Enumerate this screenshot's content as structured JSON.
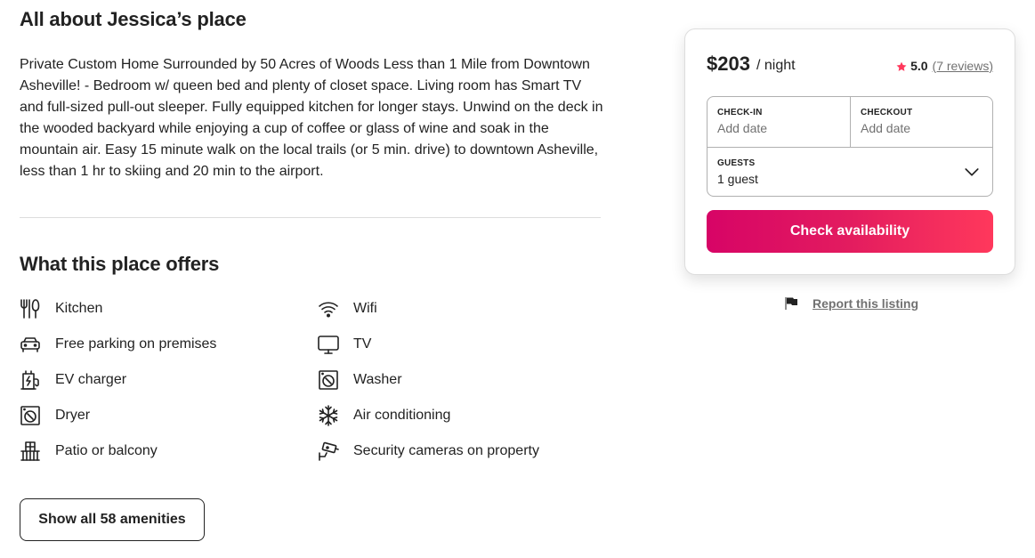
{
  "about": {
    "title": "All about Jessica’s place",
    "body": "Private Custom Home Surrounded by 50 Acres of Woods Less than 1 Mile from Downtown Asheville! - Bedroom w/ queen bed and plenty of closet space. Living room has Smart TV and full-sized pull-out sleeper. Fully equipped kitchen for longer stays. Unwind on the deck in the wooded backyard while enjoying a cup of coffee or glass of wine and soak in the mountain air. Easy 15 minute walk on the local trails (or 5 min. drive) to downtown Asheville, less than 1 hr to skiing and 20 min to the airport."
  },
  "offers": {
    "title": "What this place offers",
    "amenities": [
      {
        "label": "Kitchen",
        "icon": "kitchen-icon"
      },
      {
        "label": "Wifi",
        "icon": "wifi-icon"
      },
      {
        "label": "Free parking on premises",
        "icon": "car-icon"
      },
      {
        "label": "TV",
        "icon": "tv-icon"
      },
      {
        "label": "EV charger",
        "icon": "ev-charger-icon"
      },
      {
        "label": "Washer",
        "icon": "washer-icon"
      },
      {
        "label": "Dryer",
        "icon": "dryer-icon"
      },
      {
        "label": "Air conditioning",
        "icon": "snowflake-icon"
      },
      {
        "label": "Patio or balcony",
        "icon": "balcony-icon"
      },
      {
        "label": "Security cameras on property",
        "icon": "security-camera-icon"
      }
    ],
    "show_all_label": "Show all 58 amenities"
  },
  "booking": {
    "price": "$203",
    "per_night": "/ night",
    "rating": "5.0",
    "reviews": "(7 reviews)",
    "checkin_label": "CHECK-IN",
    "checkin_placeholder": "Add date",
    "checkout_label": "CHECKOUT",
    "checkout_placeholder": "Add date",
    "guests_label": "GUESTS",
    "guests_value": "1 guest",
    "button_label": "Check availability"
  },
  "report_label": "Report this listing",
  "colors": {
    "text": "#222222",
    "muted": "#717171",
    "accent": "#FF385C",
    "border": "#DDDDDD"
  }
}
